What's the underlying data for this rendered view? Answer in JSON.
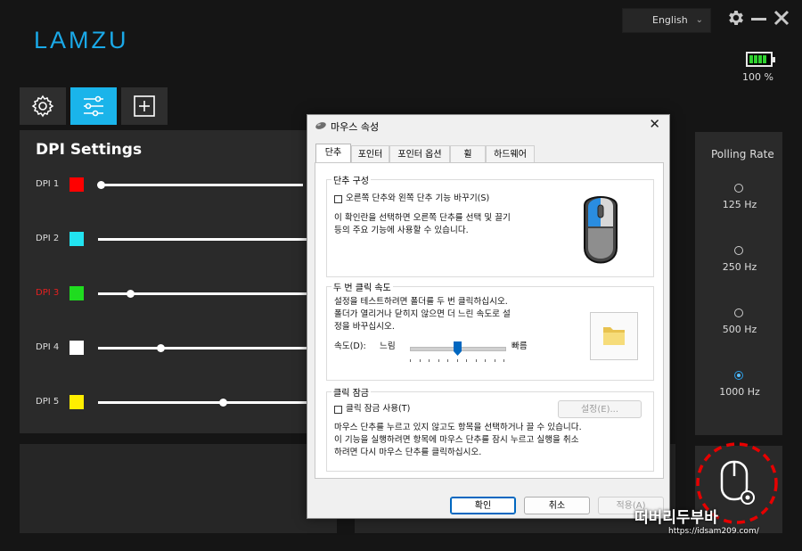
{
  "app": {
    "logo": "LAMZU",
    "language": "English",
    "battery_pct": "100 %",
    "battery_level": 1.0,
    "tabs": [
      {
        "name": "settings",
        "icon": "gear-icon",
        "active": false
      },
      {
        "name": "sliders",
        "icon": "sliders-icon",
        "active": true
      },
      {
        "name": "add",
        "icon": "plus-square-icon",
        "active": false
      }
    ]
  },
  "dpi": {
    "title": "DPI Settings",
    "items": [
      {
        "label": "DPI 1",
        "color": "#ff0000",
        "selected": false
      },
      {
        "label": "DPI 2",
        "color": "#22e3f0",
        "selected": false
      },
      {
        "label": "DPI 3",
        "color": "#1fdc1f",
        "selected": true
      },
      {
        "label": "DPI 4",
        "color": "#ffffff",
        "selected": false
      },
      {
        "label": "DPI 5",
        "color": "#ffee00",
        "selected": false
      }
    ]
  },
  "polling": {
    "title": "Polling Rate",
    "options": [
      "125 Hz",
      "250 Hz",
      "500 Hz",
      "1000 Hz"
    ],
    "selected": "1000 Hz"
  },
  "dialog": {
    "title": "마우스 속성",
    "tabs": [
      "단추",
      "포인터",
      "포인터 옵션",
      "휠",
      "하드웨어"
    ],
    "active_tab": "단추",
    "button_config": {
      "title": "단추 구성",
      "checkbox_label": "오른쪽 단추와 왼쪽 단추 기능 바꾸기(S)",
      "checked": false,
      "desc_line1": "이 확인란을 선택하면 오른쪽 단추를 선택 및 끌기",
      "desc_line2": "등의 주요 기능에 사용할 수 있습니다."
    },
    "double_click": {
      "title": "두 번 클릭 속도",
      "desc_line1": "설정을 테스트하려면 폴더를 두 번 클릭하십시오.",
      "desc_line2": "폴더가 열리거나 닫히지 않으면 더 느린 속도로 설",
      "desc_line3": "정을 바꾸십시오.",
      "speed_label": "속도(D):",
      "slow_label": "느림",
      "fast_label": "빠름",
      "speed_value": 0.5
    },
    "click_lock": {
      "title": "클릭 잠금",
      "checkbox_label": "클릭 잠금 사용(T)",
      "checked": false,
      "settings_button": "설정(E)...",
      "desc_line1": "마우스 단추를 누르고 있지 않고도 항목을 선택하거나 끌 수 있습니다.",
      "desc_line2": "이 기능을 실행하려면 항목에 마우스 단추를 잠시 누르고 실행을 취소",
      "desc_line3": "하려면 다시 마우스 단추를 클릭하십시오."
    },
    "buttons": {
      "ok": "확인",
      "cancel": "취소",
      "apply": "적용(A)"
    }
  },
  "watermark": {
    "text": "떠버리두부바",
    "url": "https://idsam209.com/"
  },
  "colors": {
    "accent": "#1ab4ea",
    "background": "#151515",
    "panel": "#2a2a2a",
    "highlight_circle": "#e60000"
  }
}
